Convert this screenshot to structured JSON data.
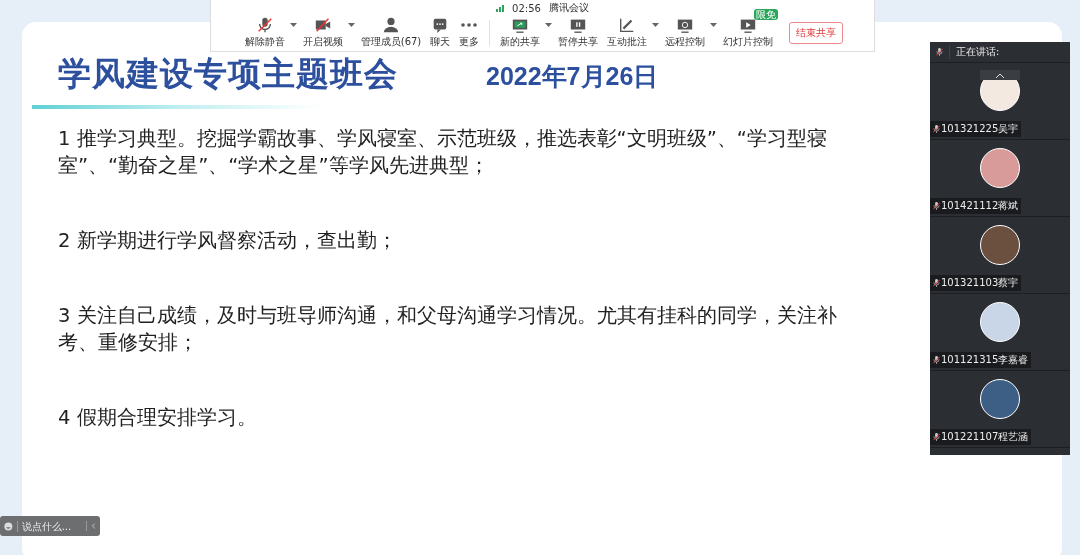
{
  "meeting_bar": {
    "signal": "02:56",
    "title": "腾讯会议",
    "tools": [
      {
        "label": "解除静音",
        "has_menu": true
      },
      {
        "label": "开启视频",
        "has_menu": true
      },
      {
        "label": "管理成员(67)",
        "has_menu": false
      },
      {
        "label": "聊天",
        "has_menu": false
      },
      {
        "label": "更多",
        "has_menu": false
      },
      {
        "label": "新的共享",
        "has_menu": true
      },
      {
        "label": "暂停共享",
        "has_menu": false
      },
      {
        "label": "互动批注",
        "has_menu": true
      },
      {
        "label": "远程控制",
        "has_menu": true
      },
      {
        "label": "幻灯片控制",
        "has_menu": false,
        "badge": "限免"
      }
    ],
    "end_button": "结束共享"
  },
  "slide": {
    "title": "学风建设专项主题班会",
    "date": "2022年7月26日",
    "points": [
      "1 推学习典型。挖掘学霸故事、学风寝室、示范班级，推选表彰“文明班级”、“学习型寝室”、“勤奋之星”、“学术之星”等学风先进典型；",
      "2 新学期进行学风督察活动，查出勤；",
      "3 关注自己成绩，及时与班导师沟通，和父母沟通学习情况。尤其有挂科的同学，关注补考、重修安排；",
      "4 假期合理安排学习。"
    ]
  },
  "participants": {
    "header": "正在讲话:",
    "list": [
      {
        "name": "101321225吴宇",
        "muted": true
      },
      {
        "name": "101421112蒋斌",
        "muted": true
      },
      {
        "name": "101321103蔡宇",
        "muted": true
      },
      {
        "name": "101121315李嘉睿",
        "muted": true
      },
      {
        "name": "101221107程艺涵",
        "muted": true
      }
    ]
  },
  "chat_bar": {
    "placeholder": "说点什么..."
  }
}
